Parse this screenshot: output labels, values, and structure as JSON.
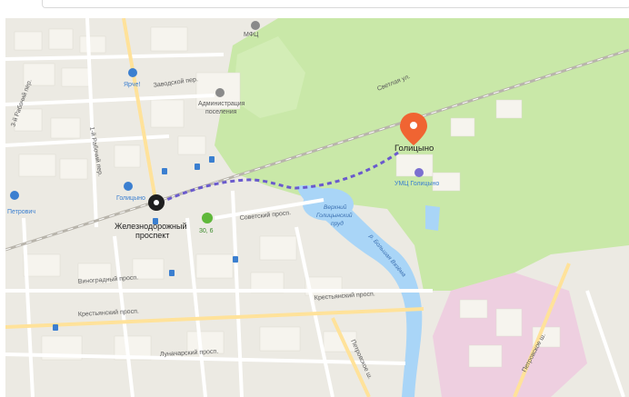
{
  "map": {
    "destination": {
      "name": "Голицыно"
    },
    "station": {
      "name_line1": "Железнодорожный",
      "name_line2": "проспект"
    },
    "bus_stop": {
      "label": "30, 6"
    },
    "pois": {
      "yarche": "Ярче!",
      "admin_line1": "Администрация",
      "admin_line2": "поселения",
      "mkfu": "МФЦ",
      "umc": "УМЦ Голицыно",
      "golitsyno_st": "Голицыно",
      "petrovich": "Петрович"
    },
    "streets": {
      "zavodskoy": "Заводской пер.",
      "rabochy": "1-й Рабочий пер.",
      "rabochy2": "3-й Рабочий пер.",
      "svetlaya": "Светлая ул.",
      "sovetsky": "Советский просп.",
      "vinogradny": "Виноградный просп.",
      "krestyansky1": "Крестьянский просп.",
      "krestyansky2": "Крестьянский просп.",
      "lunacharsky": "Луначарский просп.",
      "petrovskoe_sh1": "Петровское ш.",
      "petrovskoe_sh2": "Петровское ш.",
      "vyazyoma": "р. Большая Вязёма"
    },
    "water": {
      "pond_line1": "Верхний",
      "pond_line2": "Голицынский",
      "pond_line3": "пруд"
    },
    "colors": {
      "background": "#eceae3",
      "forest": "#c9e8a8",
      "water": "#a9d5f7",
      "route": "#6a5acd",
      "pin": "#f06432",
      "road_main": "#ffe29a",
      "hospital": "#eecfe0"
    }
  }
}
